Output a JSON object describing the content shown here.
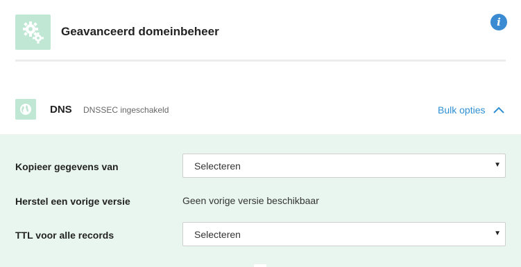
{
  "header": {
    "title": "Geavanceerd domeinbeheer",
    "icon": "gears-icon",
    "info_icon_glyph": "i"
  },
  "dns": {
    "title": "DNS",
    "subtitle": "DNSSEC ingeschakeld",
    "icon": "globe-icon",
    "bulk_label": "Bulk opties",
    "expanded": true
  },
  "form": {
    "copy_label": "Kopieer gegevens van",
    "copy_value": "Selecteren",
    "restore_label": "Herstel een vorige versie",
    "restore_value": "Geen vorige versie beschikbaar",
    "ttl_label": "TTL voor alle records",
    "ttl_value": "Selecteren",
    "caret": "▼"
  },
  "colors": {
    "accent_blue": "#2f8fd4",
    "icon_bg": "#bfe7d4",
    "panel_bg": "#e9f6f0"
  }
}
